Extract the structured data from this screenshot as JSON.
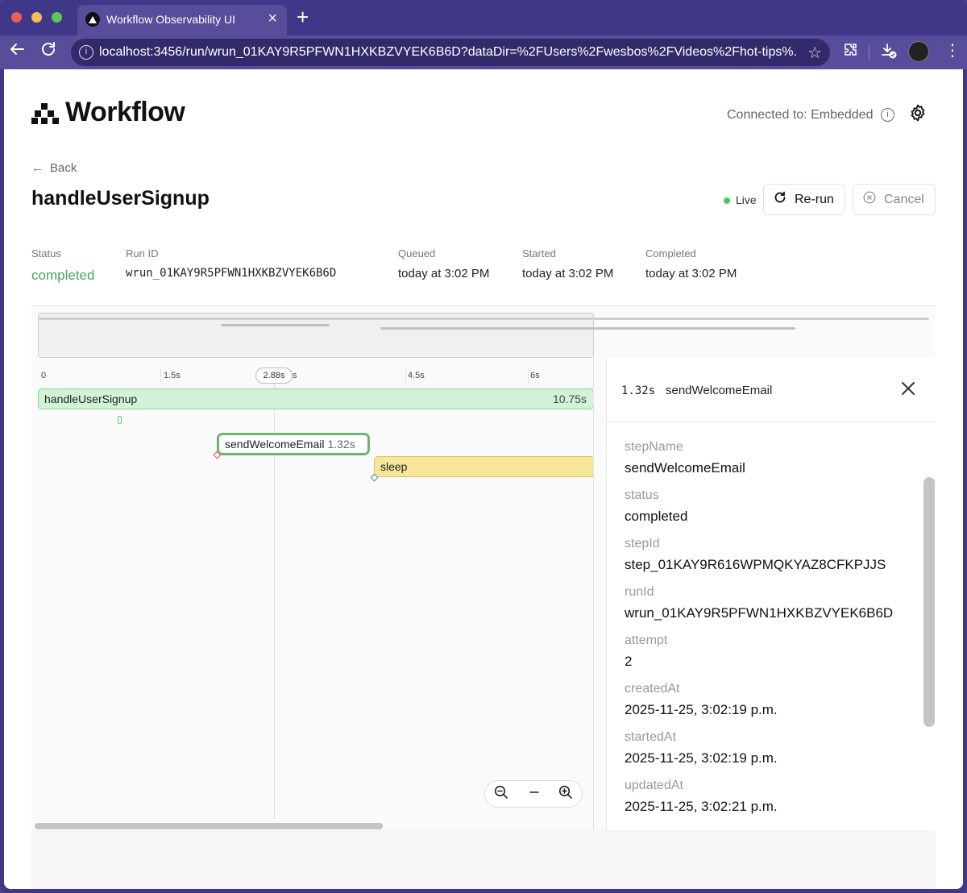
{
  "browser": {
    "tab_title": "Workflow Observability UI",
    "url": "localhost:3456/run/wrun_01KAY9R5PFWN1HXKBZVYEK6B6D?dataDir=%2FUsers%2Fwesbos%2FVideos%2Fhot-tips%..."
  },
  "header": {
    "logo_text": "Workflow",
    "connection": "Connected to: Embedded"
  },
  "run": {
    "back_label": "Back",
    "title": "handleUserSignup",
    "live_label": "Live",
    "rerun_label": "Re-run",
    "cancel_label": "Cancel",
    "meta": {
      "status_label": "Status",
      "status_value": "completed",
      "runid_label": "Run ID",
      "runid_value": "wrun_01KAY9R5PFWN1HXKBZVYEK6B6D",
      "queued_label": "Queued",
      "queued_value": "today at 3:02 PM",
      "started_label": "Started",
      "started_value": "today at 3:02 PM",
      "completed_label": "Completed",
      "completed_value": "today at 3:02 PM"
    }
  },
  "trace": {
    "ticks": [
      "0",
      "1.5s",
      "s",
      "4.5s",
      "6s"
    ],
    "cursor_label": "2.88s",
    "spans": {
      "root_name": "handleUserSignup",
      "root_duration": "10.75s",
      "email_name": "sendWelcomeEmail",
      "email_duration": "1.32s",
      "sleep_name": "sleep"
    }
  },
  "panel": {
    "duration": "1.32s",
    "name": "sendWelcomeEmail",
    "fields": [
      {
        "label": "stepName",
        "value": "sendWelcomeEmail"
      },
      {
        "label": "status",
        "value": "completed"
      },
      {
        "label": "stepId",
        "value": "step_01KAY9R616WPMQKYAZ8CFKPJJS"
      },
      {
        "label": "runId",
        "value": "wrun_01KAY9R5PFWN1HXKBZVYEK6B6D"
      },
      {
        "label": "attempt",
        "value": "2"
      },
      {
        "label": "createdAt",
        "value": "2025-11-25, 3:02:19 p.m."
      },
      {
        "label": "startedAt",
        "value": "2025-11-25, 3:02:19 p.m."
      },
      {
        "label": "updatedAt",
        "value": "2025-11-25, 3:02:21 p.m."
      }
    ]
  },
  "colors": {
    "status_completed": "#4aa560",
    "live_dot": "#4cc35d",
    "span_root_fill": "#d3f3d8",
    "span_sleep_fill": "#f5e69a",
    "browser_frame": "#3f3787"
  }
}
